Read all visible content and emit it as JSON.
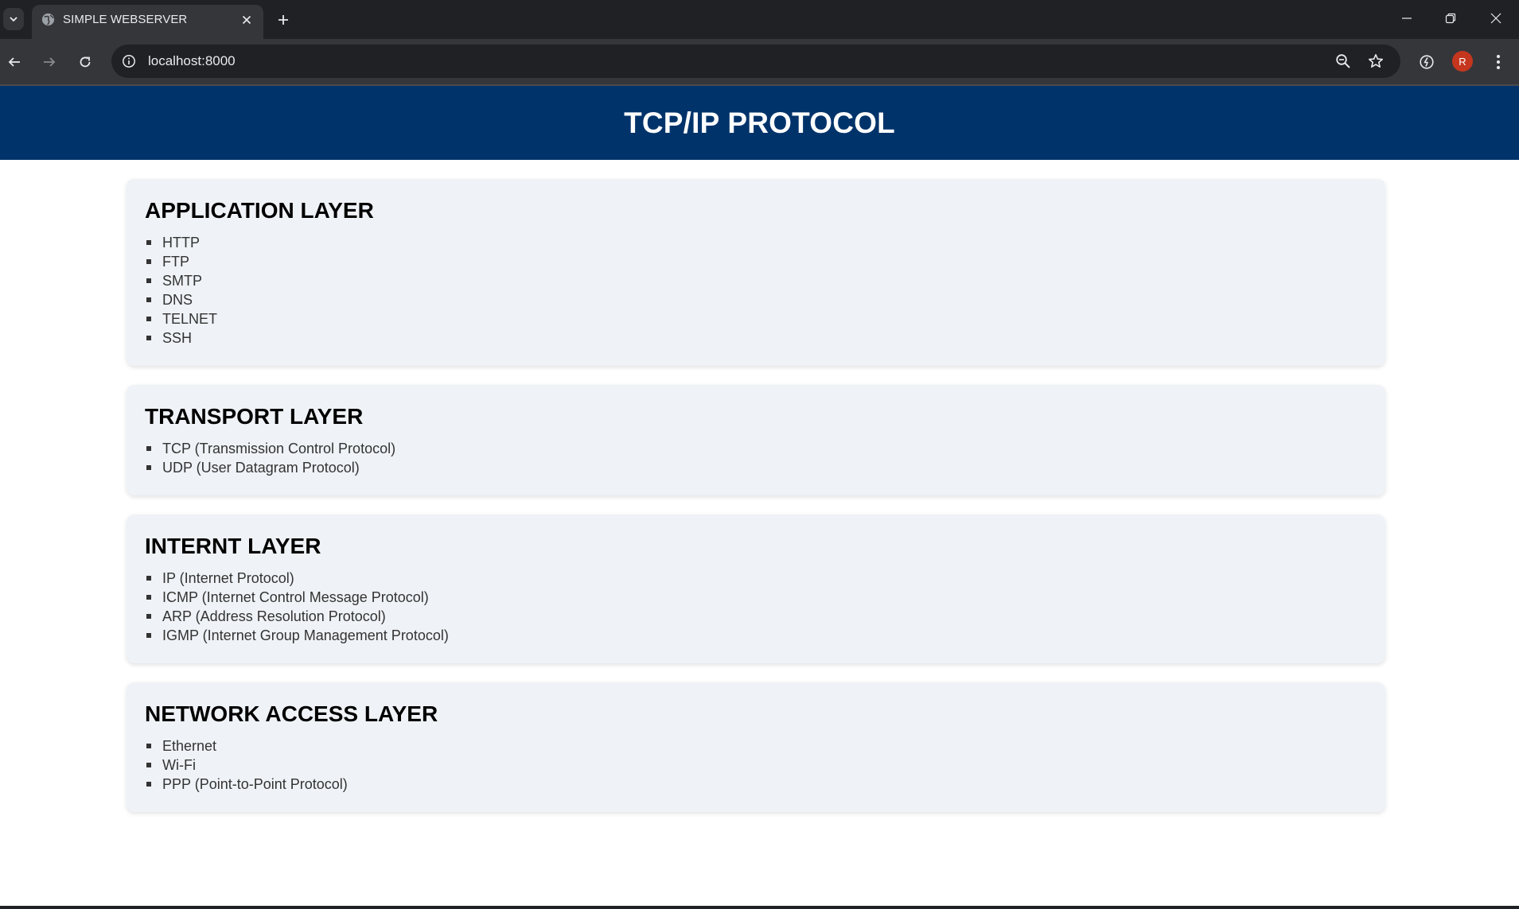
{
  "browser": {
    "tab": {
      "title": "SIMPLE WEBSERVER"
    },
    "omnibox": {
      "url": "localhost:8000"
    },
    "profile": {
      "initial": "R",
      "color": "#c5361e"
    }
  },
  "page": {
    "header": {
      "title": "TCP/IP PROTOCOL",
      "background": "#00336a"
    },
    "sections": [
      {
        "heading": "APPLICATION LAYER",
        "items": [
          "HTTP",
          "FTP",
          "SMTP",
          "DNS",
          "TELNET",
          "SSH"
        ]
      },
      {
        "heading": "TRANSPORT LAYER",
        "items": [
          "TCP (Transmission Control Protocol)",
          "UDP (User Datagram Protocol)"
        ]
      },
      {
        "heading": "INTERNT LAYER",
        "items": [
          "IP (Internet Protocol)",
          "ICMP (Internet Control Message Protocol)",
          "ARP (Address Resolution Protocol)",
          "IGMP (Internet Group Management Protocol)"
        ]
      },
      {
        "heading": "NETWORK ACCESS LAYER",
        "items": [
          "Ethernet",
          "Wi-Fi",
          "PPP (Point-to-Point Protocol)"
        ]
      }
    ]
  }
}
